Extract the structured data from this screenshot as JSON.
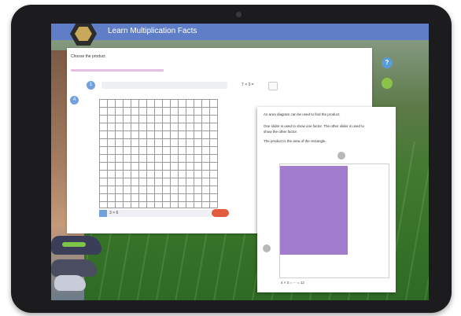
{
  "app": {
    "title": "Learn Multiplication Facts"
  },
  "question": {
    "prompt": "Choose the product.",
    "row_number": "1",
    "equation": "7 × 3 =",
    "left_marker": "4",
    "check_tag": "",
    "answer_preview": "3 × 6",
    "submit_label": ""
  },
  "side_buttons": {
    "help_label": "?"
  },
  "hint_panel": {
    "line1": "An area diagram can be used to find the product.",
    "line2a": "One slider is used to show one factor. The other slider is used to",
    "line2b": "show the other factor.",
    "line3": "The product is the area of the rectangle.",
    "formula": "4 × 3 = ⋯ = 12"
  },
  "colors": {
    "title_bar": "#5f7ec7",
    "grid_area": "#a17ccd",
    "accent_blue": "#74a0de",
    "submit_pill": "#e25b3d",
    "hint_green": "#8bc34a"
  }
}
